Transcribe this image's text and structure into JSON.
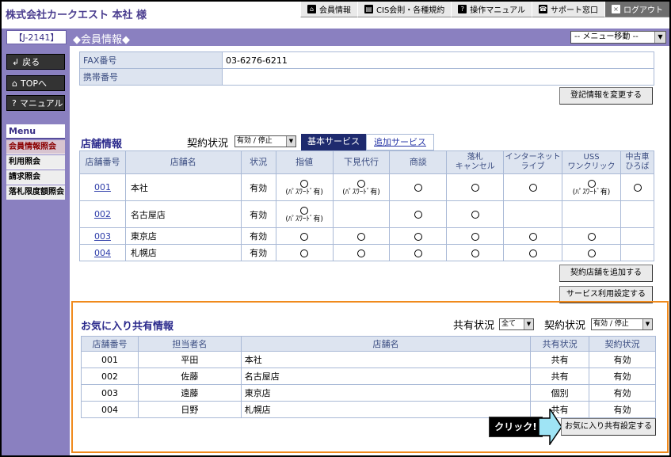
{
  "header": {
    "company": "株式会社カークエスト 本社 様",
    "nav": [
      {
        "icon": "house-icon",
        "glyph": "⌂",
        "label": "会員情報"
      },
      {
        "icon": "book-icon",
        "glyph": "▤",
        "label": "CIS会則・各種規約"
      },
      {
        "icon": "help-icon",
        "glyph": "?",
        "label": "操作マニュアル"
      },
      {
        "icon": "phone-icon",
        "glyph": "☎",
        "label": "サポート窓口"
      },
      {
        "icon": "logout-icon",
        "glyph": "×",
        "label": "ログアウト"
      }
    ]
  },
  "titlebar": {
    "member_id": "【J-2141】",
    "title": "◆会員情報◆",
    "menu_select": "-- メニュー移動 --"
  },
  "sidebar": {
    "buttons": [
      {
        "icon": "back-icon",
        "glyph": "↲",
        "label": "戻る"
      },
      {
        "icon": "home-icon",
        "glyph": "⌂",
        "label": "TOPへ"
      },
      {
        "icon": "help-icon",
        "glyph": "?",
        "label": "マニュアル"
      }
    ],
    "menu_title": "Menu",
    "menu_items": [
      "会員情報照会",
      "利用照会",
      "請求照会",
      "落札限度額照会"
    ]
  },
  "info_rows": [
    {
      "label": "FAX番号",
      "value": "03-6276-6211"
    },
    {
      "label": "携帯番号",
      "value": ""
    }
  ],
  "edit_button": "登記情報を変更する",
  "shop_section": {
    "title": "店舗情報",
    "contract_label": "契約状況",
    "contract_value": "有効 / 停止",
    "tab_basic": "基本サービス",
    "tab_extra": "追加サービス",
    "headers": [
      "店舗番号",
      "店舗名",
      "状況",
      "指値",
      "下見代行",
      "商談",
      "落札\nキャンセル",
      "インターネット\nライブ",
      "USS\nワンクリック",
      "中古車\nひろば"
    ],
    "circle": "○",
    "pw": "(ﾊﾟｽﾜｰﾄﾞ有)",
    "rows": [
      {
        "no": "001",
        "name": "本社",
        "status": "有効",
        "cells": [
          "pw",
          "pw",
          "o",
          "o",
          "o",
          "pw",
          "o"
        ]
      },
      {
        "no": "002",
        "name": "名古屋店",
        "status": "有効",
        "cells": [
          "pw",
          "",
          "o",
          "o",
          "",
          "",
          ""
        ]
      },
      {
        "no": "003",
        "name": "東京店",
        "status": "有効",
        "cells": [
          "o",
          "o",
          "o",
          "o",
          "o",
          "o",
          ""
        ]
      },
      {
        "no": "004",
        "name": "札幌店",
        "status": "有効",
        "cells": [
          "o",
          "o",
          "o",
          "o",
          "o",
          "o",
          ""
        ]
      }
    ],
    "add_button": "契約店舗を追加する",
    "service_button": "サービス利用設定する"
  },
  "fav_section": {
    "title": "お気に入り共有情報",
    "share_label": "共有状況",
    "share_value": "全て",
    "contract_label": "契約状況",
    "contract_value": "有効 / 停止",
    "headers": [
      "店舗番号",
      "担当者名",
      "店舗名",
      "共有状況",
      "契約状況"
    ],
    "rows": [
      [
        "001",
        "平田",
        "本社",
        "共有",
        "有効"
      ],
      [
        "002",
        "佐藤",
        "名古屋店",
        "共有",
        "有効"
      ],
      [
        "003",
        "遠藤",
        "東京店",
        "個別",
        "有効"
      ],
      [
        "004",
        "日野",
        "札幌店",
        "共有",
        "有効"
      ]
    ],
    "set_button": "お気に入り共有設定する",
    "callout": "クリック!"
  }
}
